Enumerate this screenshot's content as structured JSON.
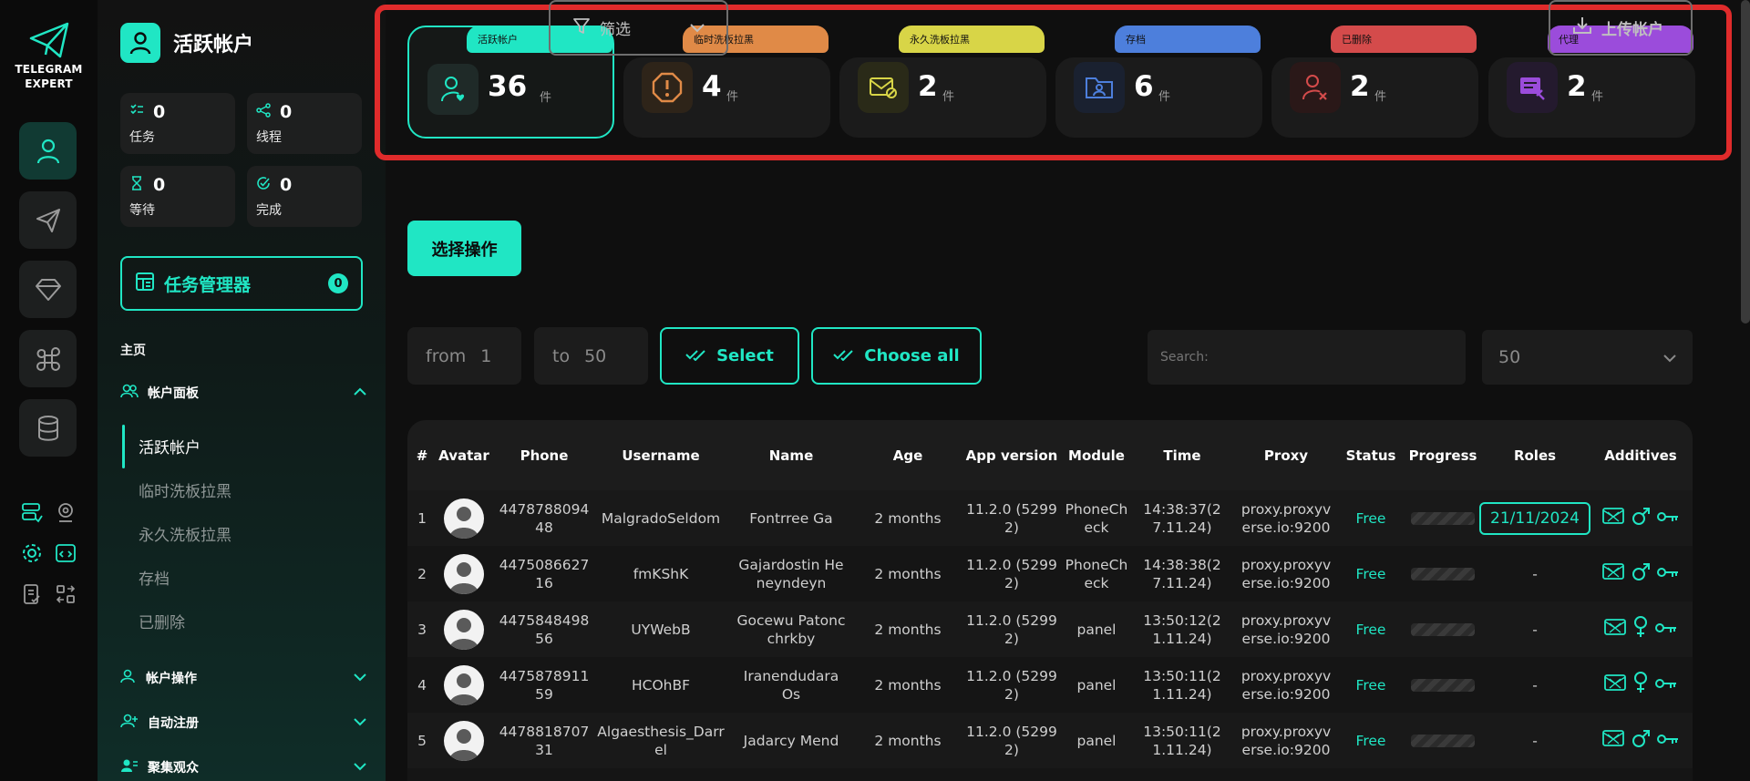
{
  "brand": {
    "line1": "TELEGRAM",
    "line2": "EXPERT"
  },
  "sidebar": {
    "title": "活跃帐户",
    "stats": [
      {
        "value": "0",
        "label": "任务"
      },
      {
        "value": "0",
        "label": "线程"
      },
      {
        "value": "0",
        "label": "等待"
      },
      {
        "value": "0",
        "label": "完成"
      }
    ],
    "task_manager": {
      "label": "任务管理器",
      "count": "0"
    },
    "home_label": "主页",
    "account_panel": {
      "label": "帐户面板",
      "items": [
        "活跃帐户",
        "临时洗板拉黑",
        "永久洗板拉黑",
        "存档",
        "已删除"
      ]
    },
    "groups": [
      "帐户操作",
      "自动注册",
      "聚集观众"
    ]
  },
  "cards": [
    {
      "tag": "活跃帐户",
      "value": "36",
      "unit": "件",
      "color": "#20e6c4",
      "icon": "user-heart-icon"
    },
    {
      "tag": "临时洗板拉黑",
      "value": "4",
      "unit": "件",
      "color": "#e08a47",
      "icon": "alert-icon"
    },
    {
      "tag": "永久洗板拉黑",
      "value": "2",
      "unit": "件",
      "color": "#d8d547",
      "icon": "mail-block-icon"
    },
    {
      "tag": "存档",
      "value": "6",
      "unit": "件",
      "color": "#4d7fdc",
      "icon": "folder-user-icon"
    },
    {
      "tag": "已删除",
      "value": "2",
      "unit": "件",
      "color": "#d44b4b",
      "icon": "user-x-icon"
    },
    {
      "tag": "代理",
      "value": "2",
      "unit": "件",
      "color": "#9b4cdb",
      "icon": "proxy-icon"
    }
  ],
  "toolbar": {
    "select_action": "选择操作",
    "filter": "筛选",
    "upload": "上传帐户"
  },
  "range": {
    "from_label": "from",
    "from_value": "1",
    "to_label": "to",
    "to_value": "50",
    "select": "Select",
    "choose_all": "Choose all",
    "search_placeholder": "Search:",
    "per_page": "50"
  },
  "table": {
    "headers": [
      "#",
      "Avatar",
      "Phone",
      "Username",
      "Name",
      "Age",
      "App version",
      "Module",
      "Time",
      "Proxy",
      "Status",
      "Progress",
      "Roles",
      "Additives"
    ],
    "rows": [
      {
        "n": "1",
        "phone": "447878809448",
        "username": "MalgradoSeldom",
        "name": "Fontrree Ga",
        "age": "2 months",
        "app": "11.2.0 (52992)",
        "module": "PhoneCheck",
        "time": "14:38:37(27.11.24)",
        "proxy": "proxy.proxyverse.io:9200",
        "status": "Free",
        "roles": "21/11/2024",
        "gender": "male"
      },
      {
        "n": "2",
        "phone": "447508662716",
        "username": "fmKShK",
        "name": "Gajardostin Heneyndeyn",
        "age": "2 months",
        "app": "11.2.0 (52992)",
        "module": "PhoneCheck",
        "time": "14:38:38(27.11.24)",
        "proxy": "proxy.proxyverse.io:9200",
        "status": "Free",
        "roles": "-",
        "gender": "male"
      },
      {
        "n": "3",
        "phone": "447584849856",
        "username": "UYWebB",
        "name": "Gocewu Patoncchrkby",
        "age": "2 months",
        "app": "11.2.0 (52992)",
        "module": "panel",
        "time": "13:50:12(21.11.24)",
        "proxy": "proxy.proxyverse.io:9200",
        "status": "Free",
        "roles": "-",
        "gender": "female"
      },
      {
        "n": "4",
        "phone": "447587891159",
        "username": "HCOhBF",
        "name": "Iranendudara Os",
        "age": "2 months",
        "app": "11.2.0 (52992)",
        "module": "panel",
        "time": "13:50:11(21.11.24)",
        "proxy": "proxy.proxyverse.io:9200",
        "status": "Free",
        "roles": "-",
        "gender": "female"
      },
      {
        "n": "5",
        "phone": "447881870731",
        "username": "Algaesthesis_Darrel",
        "name": "Jadarcy Mend",
        "age": "2 months",
        "app": "11.2.0 (52992)",
        "module": "panel",
        "time": "13:50:11(21.11.24)",
        "proxy": "proxy.proxyverse.io:9200",
        "status": "Free",
        "roles": "-",
        "gender": "male"
      }
    ]
  },
  "colors": {
    "accent": "#20e6c4",
    "highlight": "#e02b2b"
  }
}
